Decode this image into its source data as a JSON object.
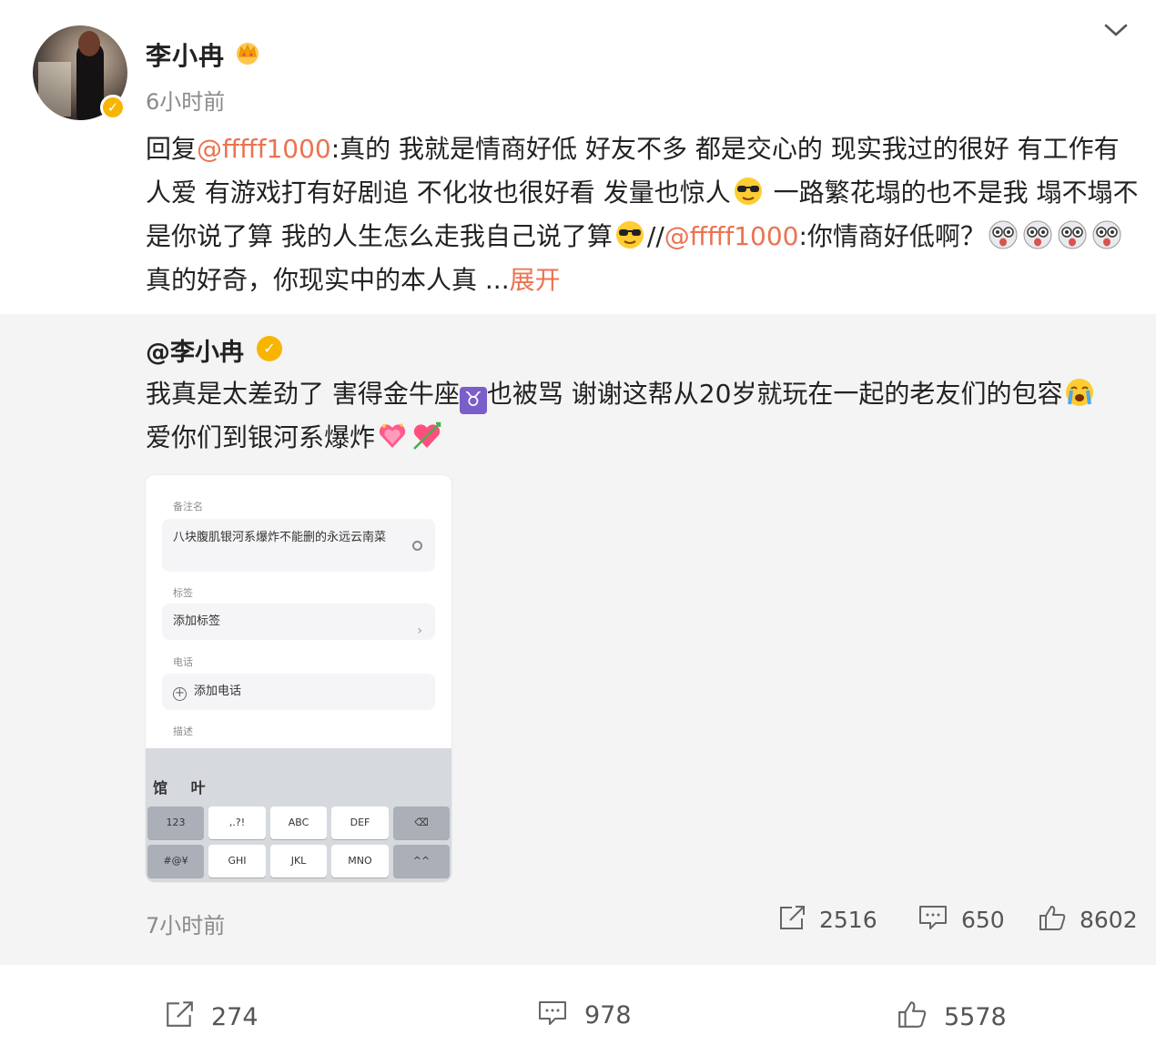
{
  "post": {
    "username": "李小冉",
    "time": "6小时前",
    "text": {
      "prefix": "回复",
      "mention1": "@fffff1000",
      "part1": ":真的 我就是情商好低 好友不多 都是交心的 现实我过的很好 有工作有人爱 有游戏打有好剧追 不化妆也很好看 发量也惊人",
      "part2": " 一路繁花塌的也不是我 塌不塌不是你说了算 我的人生怎么走我自己说了算",
      "part3": "//",
      "mention2": "@fffff1000",
      "part4": ":你情商好低啊？",
      "part5": "　真的好奇，你现实中的本人真 ...",
      "expand": "展开"
    }
  },
  "repost": {
    "username": "@李小冉",
    "text": {
      "part1": "我真是太差劲了 害得金牛座",
      "taurus": "♉",
      "part2": "也被骂 谢谢这帮从20岁就玩在一起的老友们的包容",
      "part3": "爱你们到银河系爆炸"
    },
    "screenshot": {
      "label_note": "备注名",
      "note_value": "八块腹肌银河系爆炸不能删的永远云南菜",
      "label_tags": "标签",
      "tags_value": "添加标签",
      "tags_arrow": "›",
      "label_phone": "电话",
      "phone_value": "添加电话",
      "label_desc": "描述",
      "candidates": "馆 叶",
      "keys": [
        "123",
        ",.?!",
        "ABC",
        "DEF",
        "⌫",
        "#@¥",
        "GHI",
        "JKL",
        "MNO",
        "^^"
      ]
    },
    "time": "7小时前",
    "stats": {
      "reposts": "2516",
      "comments": "650",
      "likes": "8602"
    }
  },
  "footer": {
    "reposts": "274",
    "comments": "978",
    "likes": "5578"
  },
  "colors": {
    "accent": "#eb7350",
    "verified": "#f7b500",
    "repost_bg": "#f4f4f4"
  },
  "icons": [
    "crown-icon",
    "verified-icon",
    "chevron-down-icon",
    "sunglasses-emoji",
    "shocked-emoji",
    "crying-emoji",
    "heart-emoji",
    "share-icon",
    "comment-icon",
    "like-icon"
  ]
}
